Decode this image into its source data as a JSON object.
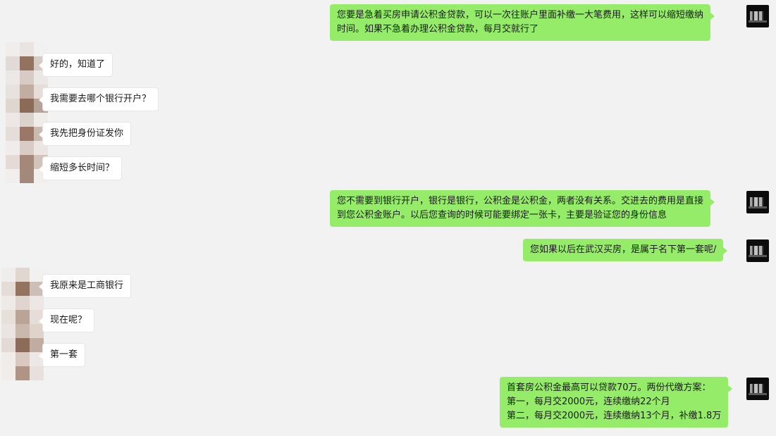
{
  "messages": [
    {
      "side": "me",
      "lines": [
        "您要是急着买房申请公积金贷款，可以一次往账户里面补缴一大笔费用，这样可以缩短缴纳",
        "时间。如果不急着办理公积金贷款，每月交就行了"
      ]
    },
    {
      "side": "them",
      "lines": [
        "好的，知道了"
      ]
    },
    {
      "side": "them",
      "lines": [
        "我需要去哪个银行开户？"
      ]
    },
    {
      "side": "them",
      "lines": [
        "我先把身份证发你"
      ]
    },
    {
      "side": "them",
      "lines": [
        "缩短多长时间？"
      ]
    },
    {
      "side": "me",
      "lines": [
        "您不需要到银行开户，银行是银行，公积金是公积金，两者没有关系。交进去的费用是直接",
        "到您公积金账户。以后您查询的时候可能要绑定一张卡，主要是验证您的身份信息"
      ]
    },
    {
      "side": "me",
      "lines": [
        "您如果以后在武汉买房，是属于名下第一套呢/"
      ]
    },
    {
      "side": "them",
      "lines": [
        "我原来是工商银行"
      ]
    },
    {
      "side": "them",
      "lines": [
        "现在呢？"
      ]
    },
    {
      "side": "them",
      "lines": [
        "第一套"
      ]
    },
    {
      "side": "me",
      "lines": [
        "首套房公积金最高可以贷款70万。两份代缴方案：",
        "第一，每月交2000元，连续缴纳22个月",
        "第二，每月交2000元，连续缴纳13个月，补缴1.8万"
      ]
    }
  ],
  "avatars": {
    "me": {
      "icon": "user-avatar-icon"
    },
    "them": {
      "icon": "blurred-avatar-icon"
    }
  },
  "colors": {
    "background": "#f2f2f2",
    "my_bubble": "#95ec69",
    "their_bubble": "#ffffff"
  }
}
